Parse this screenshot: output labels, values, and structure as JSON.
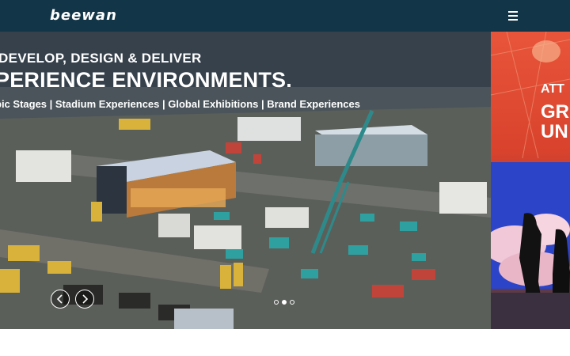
{
  "header": {
    "logo": "beewan",
    "menu_icon": "hamburger-menu-icon",
    "background_color": "#133548"
  },
  "hero": {
    "headline_line1": "DEVELOP, DESIGN & DELIVER",
    "headline_line2": "PERIENCE ENVIRONMENTS.",
    "subline": "pic Stages | Stadium Experiences | Global Exhibitions | Brand Experiences",
    "next_slide": {
      "line1": "ATT",
      "line2": "GR",
      "line3": "UN"
    },
    "prev_icon": "chevron-left-icon",
    "next_icon": "chevron-right-icon",
    "dots": [
      {
        "active": false
      },
      {
        "active": true
      },
      {
        "active": false
      }
    ]
  }
}
